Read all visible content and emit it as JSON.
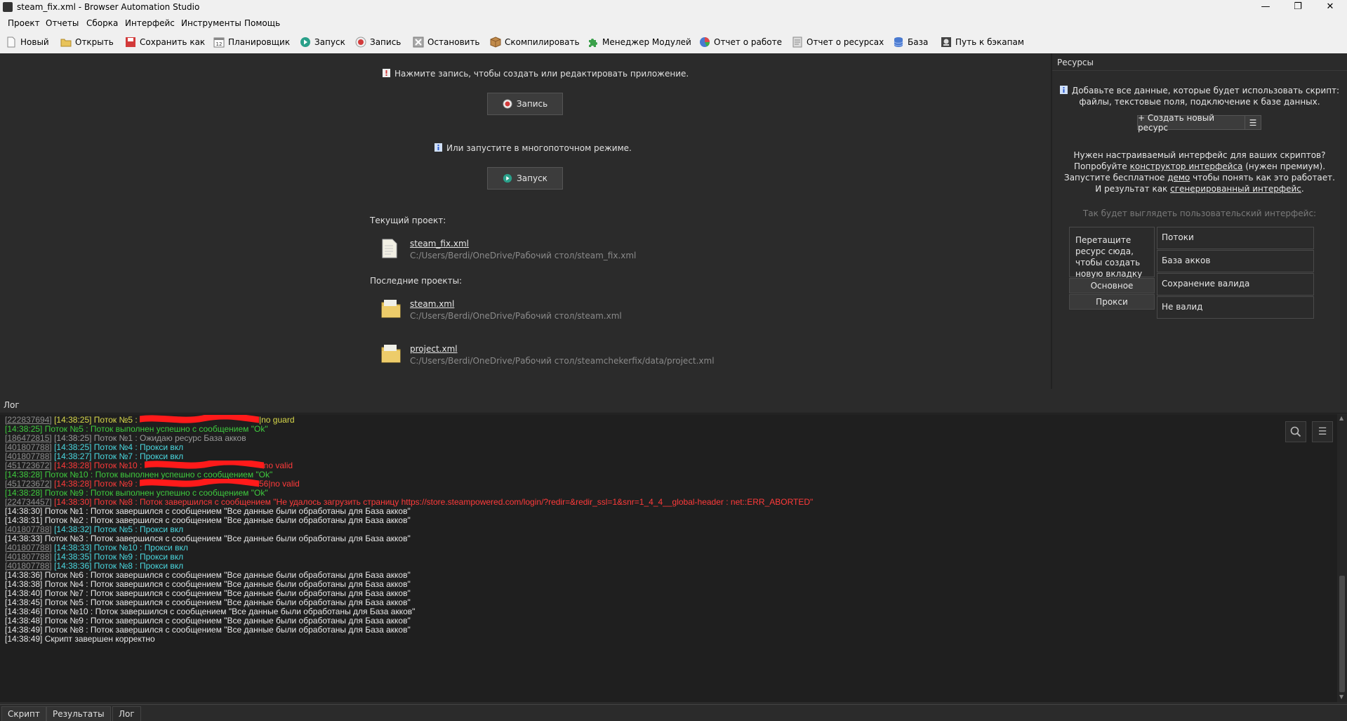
{
  "window": {
    "title": "steam_fix.xml - Browser Automation Studio",
    "minimize": "—",
    "maximize": "❐",
    "close": "✕"
  },
  "menu": [
    "Проект",
    "Отчеты",
    "Сборка",
    "Интерфейс",
    "Инструменты",
    "Помощь"
  ],
  "toolbar": [
    {
      "label": "Новый",
      "icon": "new-file-icon",
      "color": "#f2f2f2"
    },
    {
      "label": "Открыть",
      "icon": "folder-icon",
      "color": "#e8c35a"
    },
    {
      "label": "Сохранить как",
      "icon": "save-icon",
      "color": "#d23a3a"
    },
    {
      "label": "Планировщик",
      "icon": "calendar-icon",
      "color": "#9a9a9a"
    },
    {
      "label": "Запуск",
      "icon": "play-icon",
      "color": "#2aa08a"
    },
    {
      "label": "Запись",
      "icon": "record-icon",
      "color": "#d23a3a"
    },
    {
      "label": "Остановить",
      "icon": "stop-icon",
      "color": "#8a8a8a"
    },
    {
      "label": "Скомпилировать",
      "icon": "package-icon",
      "color": "#c08a4a"
    },
    {
      "label": "Менеджер Модулей",
      "icon": "puzzle-icon",
      "color": "#3aa04a"
    },
    {
      "label": "Отчет о работе",
      "icon": "pie-chart-icon",
      "color": "#4a7ad0"
    },
    {
      "label": "Отчет о ресурсах",
      "icon": "document-icon",
      "color": "#9a9a9a"
    },
    {
      "label": "База",
      "icon": "database-icon",
      "color": "#4a7ad0"
    },
    {
      "label": "Путь к бэкапам",
      "icon": "backup-icon",
      "color": "#555555"
    }
  ],
  "main": {
    "record_hint": "Нажмите запись, чтобы создать или редактировать приложение.",
    "record_button": "Запись",
    "run_hint": "Или запустите в многопоточном режиме.",
    "run_button": "Запуск",
    "current_label": "Текущий проект:",
    "current_project": {
      "name": "steam_fix.xml",
      "path": "C:/Users/Berdi/OneDrive/Рабочий стол/steam_fix.xml"
    },
    "recent_label": "Последние проекты:",
    "recent_projects": [
      {
        "name": "steam.xml",
        "path": "C:/Users/Berdi/OneDrive/Рабочий стол/steam.xml"
      },
      {
        "name": "project.xml",
        "path": "C:/Users/Berdi/OneDrive/Рабочий стол/steamchekerfix/data/project.xml"
      }
    ]
  },
  "resources": {
    "title": "Ресурсы",
    "hint_line1": "Добавьте все данные, которые будет использовать скрипт:",
    "hint_line2": "файлы, текстовые поля, подключение к базе данных.",
    "create_button": "+ Создать новый ресурс",
    "promo": {
      "l1": "Нужен настраиваемый интерфейс для ваших скриптов?",
      "l2a": "Попробуйте ",
      "l2link": "конструктор интерфейса",
      "l2b": " (нужен премиум).",
      "l3a": "Запустите бесплатное ",
      "l3link": "демо",
      "l3b": " чтобы понять как это работает.",
      "l4a": "И результат как ",
      "l4link": "сгенерированный интерфейс",
      "l4b": "."
    },
    "preview_caption": "Так будет выглядеть пользовательский интерфейс:",
    "preview": {
      "drop_text": "Перетащите ресурс сюда, чтобы создать новую вкладку",
      "tabs": [
        "Основное",
        "Прокси"
      ],
      "fields": [
        "Потоки",
        "База акков",
        "Сохранение валида",
        "Не валид"
      ]
    }
  },
  "log": {
    "header": "Лог",
    "colors": {
      "yellow": "#d8d84a",
      "green": "#3ecb3e",
      "gray": "#9a9a9a",
      "cyan": "#4ad8e0",
      "red": "#ff3a3a",
      "white": "#e8e8e8"
    },
    "lines": [
      {
        "id": "[222837694]",
        "text": "[14:38:25] Поток №5 : ",
        "tail": "|no guard",
        "color": "yellow",
        "redacted": true
      },
      {
        "id": "",
        "text": "[14:38:25] Поток №5 : Поток выполнен успешно с сообщением \"Ok\"",
        "color": "green"
      },
      {
        "id": "[186472815]",
        "text": "[14:38:25] Поток №1 : Ожидаю ресурс База акков",
        "color": "gray"
      },
      {
        "id": "[401807788]",
        "text": "[14:38:25] Поток №4 : Прокси вкл",
        "color": "cyan"
      },
      {
        "id": "[401807788]",
        "text": "[14:38:27] Поток №7 : Прокси вкл",
        "color": "cyan"
      },
      {
        "id": "[451723672]",
        "text": "[14:38:28] Поток №10 : ",
        "tail": "no valid",
        "color": "red",
        "redacted": true
      },
      {
        "id": "",
        "text": "[14:38:28] Поток №10 : Поток выполнен успешно с сообщением \"Ok\"",
        "color": "green"
      },
      {
        "id": "[451723672]",
        "text": "[14:38:28] Поток №9 : ",
        "tail": "56|no valid",
        "color": "red",
        "redacted": true
      },
      {
        "id": "",
        "text": "[14:38:28] Поток №9 : Поток выполнен успешно с сообщением \"Ok\"",
        "color": "green"
      },
      {
        "id": "[224734457]",
        "text": "[14:38:30] Поток №8 : Поток завершился с сообщением \"Не удалось загрузить страницу https://store.steampowered.com/login/?redir=&redir_ssl=1&snr=1_4_4__global-header : net::ERR_ABORTED\"",
        "color": "red"
      },
      {
        "id": "",
        "text": "[14:38:30] Поток №1 : Поток завершился с сообщением \"Все данные были обработаны для База акков\"",
        "color": "white"
      },
      {
        "id": "",
        "text": "[14:38:31] Поток №2 : Поток завершился с сообщением \"Все данные были обработаны для База акков\"",
        "color": "white"
      },
      {
        "id": "[401807788]",
        "text": "[14:38:32] Поток №5 : Прокси вкл",
        "color": "cyan"
      },
      {
        "id": "",
        "text": "[14:38:33] Поток №3 : Поток завершился с сообщением \"Все данные были обработаны для База акков\"",
        "color": "white"
      },
      {
        "id": "[401807788]",
        "text": "[14:38:33] Поток №10 : Прокси вкл",
        "color": "cyan"
      },
      {
        "id": "[401807788]",
        "text": "[14:38:35] Поток №9 : Прокси вкл",
        "color": "cyan"
      },
      {
        "id": "[401807788]",
        "text": "[14:38:36] Поток №8 : Прокси вкл",
        "color": "cyan"
      },
      {
        "id": "",
        "text": "[14:38:36] Поток №6 : Поток завершился с сообщением \"Все данные были обработаны для База акков\"",
        "color": "white"
      },
      {
        "id": "",
        "text": "[14:38:38] Поток №4 : Поток завершился с сообщением \"Все данные были обработаны для База акков\"",
        "color": "white"
      },
      {
        "id": "",
        "text": "[14:38:40] Поток №7 : Поток завершился с сообщением \"Все данные были обработаны для База акков\"",
        "color": "white"
      },
      {
        "id": "",
        "text": "[14:38:45] Поток №5 : Поток завершился с сообщением \"Все данные были обработаны для База акков\"",
        "color": "white"
      },
      {
        "id": "",
        "text": "[14:38:46] Поток №10 : Поток завершился с сообщением \"Все данные были обработаны для База акков\"",
        "color": "white"
      },
      {
        "id": "",
        "text": "[14:38:48] Поток №9 : Поток завершился с сообщением \"Все данные были обработаны для База акков\"",
        "color": "white"
      },
      {
        "id": "",
        "text": "[14:38:49] Поток №8 : Поток завершился с сообщением \"Все данные были обработаны для База акков\"",
        "color": "white"
      },
      {
        "id": "",
        "text": "[14:38:49] Скрипт завершен корректно",
        "color": "white"
      }
    ]
  },
  "bottom_tabs": [
    "Скрипт",
    "Результаты",
    "Лог"
  ]
}
